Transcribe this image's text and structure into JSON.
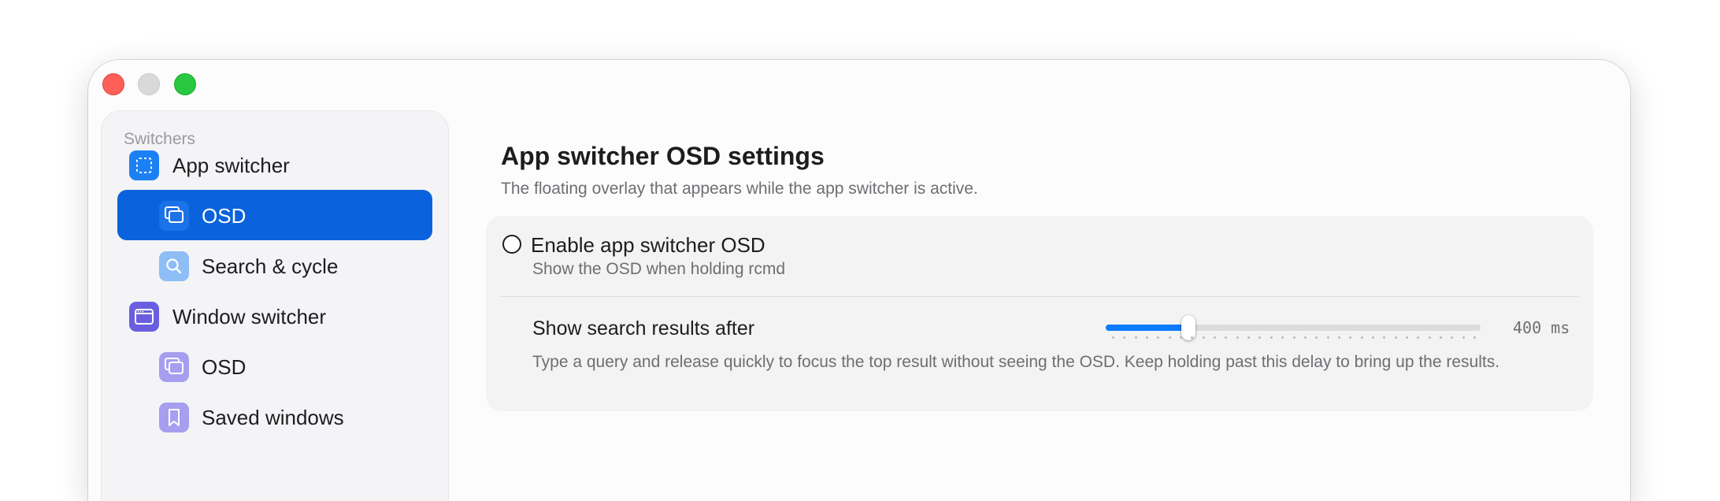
{
  "sidebar": {
    "heading": "Switchers",
    "items": [
      {
        "label": "App switcher",
        "icon": "app-switcher-icon"
      },
      {
        "label": "OSD",
        "icon": "osd-icon",
        "selected": true
      },
      {
        "label": "Search & cycle",
        "icon": "search-icon"
      },
      {
        "label": "Window switcher",
        "icon": "window-switcher-icon"
      },
      {
        "label": "OSD",
        "icon": "osd-icon"
      },
      {
        "label": "Saved windows",
        "icon": "bookmark-icon"
      }
    ]
  },
  "main": {
    "title": "App switcher OSD settings",
    "subtitle": "The floating overlay that appears while the app switcher is active.",
    "enable_osd": {
      "label": "Enable app switcher OSD",
      "description": "Show the OSD when holding rcmd",
      "checked": false
    },
    "search_delay": {
      "label": "Show search results after",
      "value_text": "400 ms",
      "fraction": 0.22,
      "tick_count": 33,
      "description": "Type a query and release quickly to focus the top result without seeing the OSD. Keep holding past this delay to bring up the results."
    }
  },
  "colors": {
    "accent": "#0a63dc",
    "slider_fill": "#0a7aff"
  }
}
